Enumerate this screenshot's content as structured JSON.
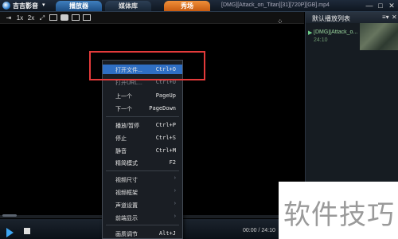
{
  "app": {
    "name": "吉吉影音",
    "dropdown_glyph": "▾",
    "window_title": "[DMG][Attack_on_Titan][31][720P][GB].mp4"
  },
  "tabs": [
    {
      "label": "播放器"
    },
    {
      "label": "媒体库"
    },
    {
      "label": "秀场"
    }
  ],
  "window_buttons": {
    "minimize": "—",
    "maximize": "□",
    "close": "✕"
  },
  "toolbar": {
    "items": [
      "⇥",
      "1x",
      "2x",
      "⤢"
    ],
    "corner_glyph": "⁘"
  },
  "playlist": {
    "title": "默认播放列表",
    "menu_glyph": "≡▾",
    "close_glyph": "✕",
    "items": [
      {
        "name": "[DMG][Attack_o...",
        "duration": "24:10",
        "playing": true
      }
    ]
  },
  "controls": {
    "time": "00:00 / 24:10"
  },
  "context_menu": {
    "items": [
      {
        "label": "打开文件...",
        "shortcut": "Ctrl+O",
        "highlighted": true
      },
      {
        "label": "打开URL...",
        "shortcut": "Ctrl+U",
        "dim": true
      },
      {
        "label": "上一个",
        "shortcut": "PageUp"
      },
      {
        "label": "下一个",
        "shortcut": "PageDown"
      },
      {
        "label": "播放/暂停",
        "shortcut": "Ctrl+P"
      },
      {
        "label": "停止",
        "shortcut": "Ctrl+S"
      },
      {
        "label": "静音",
        "shortcut": "Ctrl+M"
      },
      {
        "label": "精简模式",
        "shortcut": "F2"
      },
      {
        "label": "视频尺寸",
        "submenu": "›"
      },
      {
        "label": "视频框架",
        "submenu": "›"
      },
      {
        "label": "声道设置",
        "submenu": "›"
      },
      {
        "label": "前端显示",
        "submenu": "›"
      },
      {
        "label": "画质调节",
        "shortcut": "Alt+J"
      }
    ]
  },
  "watermark": {
    "text": "软件技巧"
  },
  "colors": {
    "highlight": "#2f6fc4",
    "red_box": "#e33a3a",
    "play_accent": "#3da5f2",
    "store_tab": "#e07a2a"
  }
}
